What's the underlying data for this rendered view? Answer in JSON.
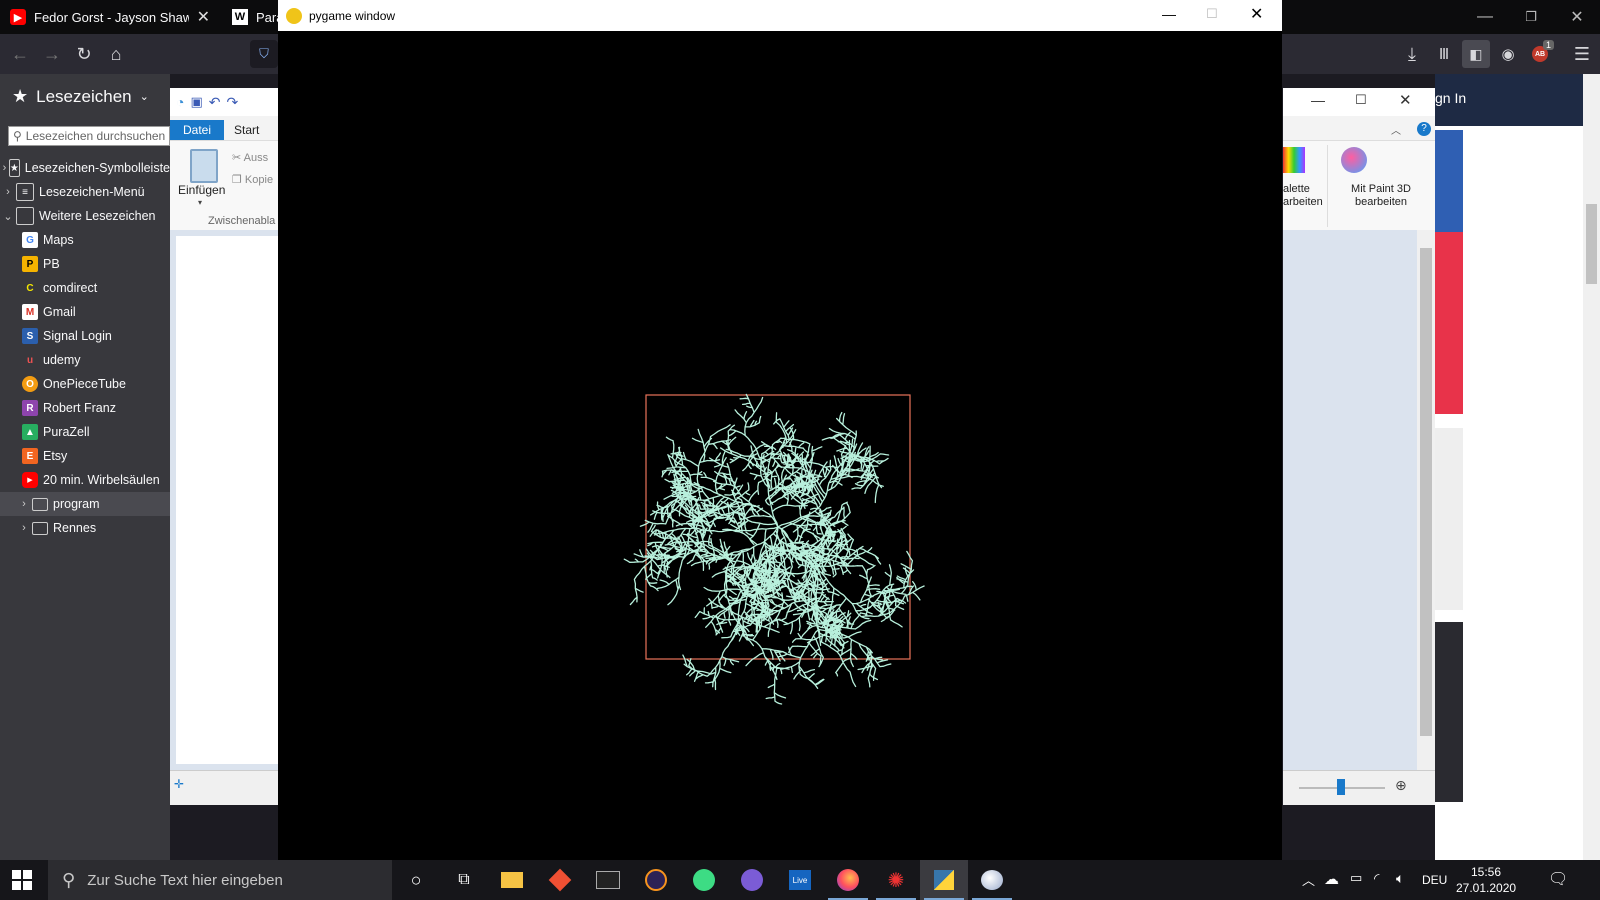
{
  "browser": {
    "tabs": [
      {
        "title": "Fedor Gorst - Jayson Shaw | Der",
        "icon": "youtube-icon"
      },
      {
        "title": "Para",
        "icon": "wikipedia-icon"
      }
    ],
    "badge_count": "1"
  },
  "sidebar": {
    "title": "Lesezeichen",
    "search_placeholder": "Lesezeichen durchsuchen",
    "items": [
      {
        "label": "Lesezeichen-Symbolleiste",
        "kind": "folder"
      },
      {
        "label": "Lesezeichen-Menü",
        "kind": "folder"
      },
      {
        "label": "Weitere Lesezeichen",
        "kind": "folder-open"
      },
      {
        "label": "Maps",
        "icon_letter": "G",
        "icon_color": "#4285f4"
      },
      {
        "label": "PB",
        "icon_letter": "P",
        "icon_color": "#f5b300"
      },
      {
        "label": "comdirect",
        "icon_letter": "C",
        "icon_color": "#f2e600"
      },
      {
        "label": "Gmail",
        "icon_letter": "M",
        "icon_color": "#d93025"
      },
      {
        "label": "Signal Login",
        "icon_letter": "S",
        "icon_color": "#2b5fad"
      },
      {
        "label": "udemy",
        "icon_letter": "u",
        "icon_color": "#ec5252"
      },
      {
        "label": "OnePieceTube",
        "icon_letter": "O",
        "icon_color": "#f39c12"
      },
      {
        "label": "Robert Franz",
        "icon_letter": "R",
        "icon_color": "#8e44ad"
      },
      {
        "label": "PuraZell",
        "icon_letter": "P",
        "icon_color": "#27ae60"
      },
      {
        "label": "Etsy",
        "icon_letter": "E",
        "icon_color": "#f16521"
      },
      {
        "label": "20 min. Wirbelsäulen",
        "icon_letter": "▶",
        "icon_color": "#ff0000"
      },
      {
        "label": "program",
        "kind": "folder"
      },
      {
        "label": "Rennes",
        "kind": "folder"
      }
    ]
  },
  "paint": {
    "tab_file": "Datei",
    "tab_start": "Start",
    "paste_label": "Einfügen",
    "cut_label": "Auss",
    "copy_label": "Kopie",
    "clipboard_group": "Zwischenabla",
    "palette_label_1": "alette",
    "palette_label_2": "arbeiten",
    "paint3d_label_1": "Mit Paint 3D",
    "paint3d_label_2": "bearbeiten"
  },
  "web_right": {
    "signin": "gn In"
  },
  "pygame": {
    "title": "pygame window",
    "box_color": "#e8735a",
    "fractal_color": "#b8f0dc"
  },
  "taskbar": {
    "search_placeholder": "Zur Suche Text hier eingeben",
    "language": "DEU",
    "time": "15:56",
    "date": "27.01.2020"
  }
}
